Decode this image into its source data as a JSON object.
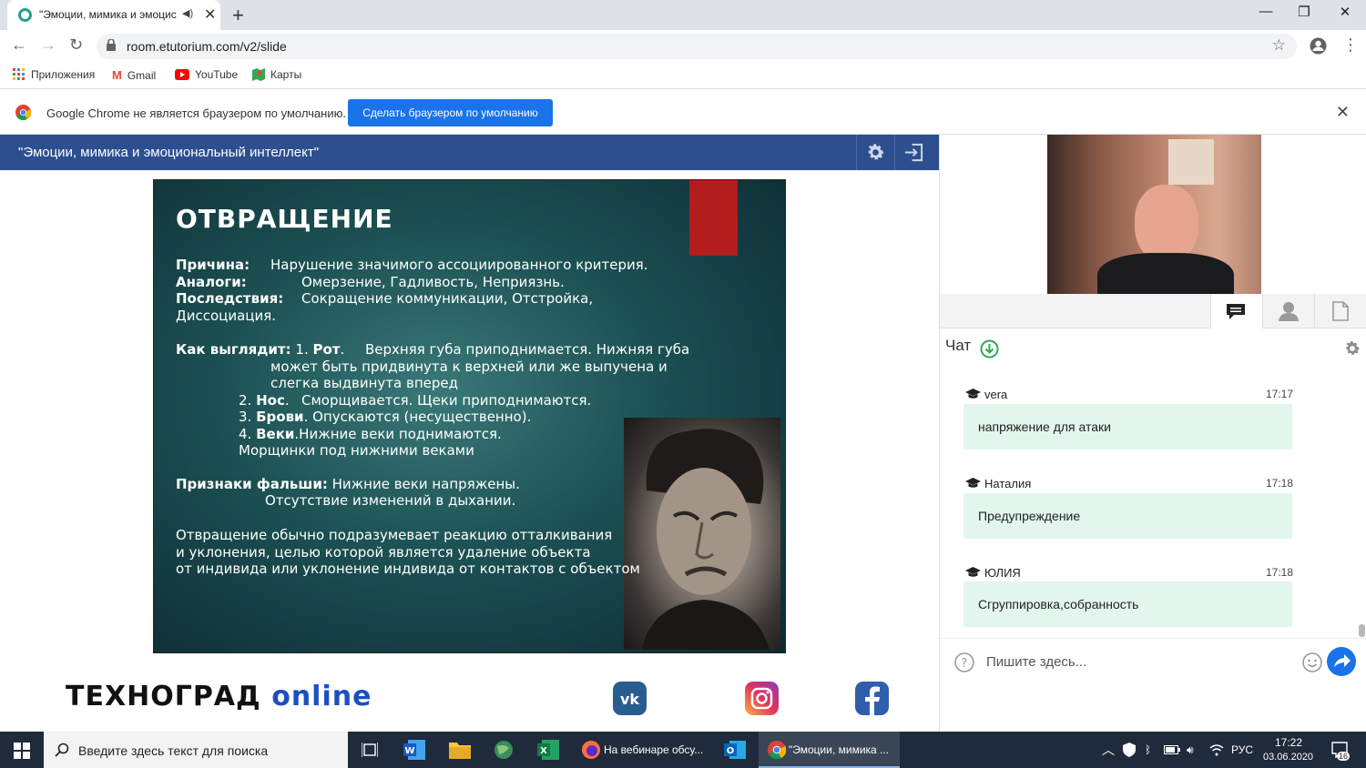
{
  "browser": {
    "tab_title": "\"Эмоции, мимика и эмоцис",
    "url": "room.etutorium.com/v2/slide",
    "bookmarks": [
      "Приложения",
      "Gmail",
      "YouTube",
      "Карты"
    ],
    "infobar_text": "Google Chrome не является браузером по умолчанию.",
    "infobar_button": "Сделать браузером по умолчанию"
  },
  "app": {
    "title": "\"Эмоции, мимика и эмоциональный интеллект\""
  },
  "slide": {
    "heading": "ОТВРАЩЕНИЕ",
    "cause_label": "Причина:",
    "cause_text": "Нарушение значимого ассоциированного критерия.",
    "analogs_label": "Аналоги:",
    "analogs_text": "Омерзение, Гадливость, Неприязнь.",
    "consequences_label": "Последствия:",
    "consequences_text": "Сокращение коммуникации, Отстройка,",
    "consequences_text2": "Диссоциация.",
    "looks_label": "Как выглядит:",
    "mouth_num": "1.",
    "mouth_label": "Рот",
    "mouth_text": "Верхняя губа приподнимается. Нижняя губа",
    "mouth_text2": "может быть придвинута к верхней или же выпучена и",
    "mouth_text3": "слегка выдвинута вперед",
    "nose_num": "2.",
    "nose_label": "Нос",
    "nose_text": "Сморщивается. Щеки приподнимаются.",
    "brows_num": "3.",
    "brows_label": "Брови",
    "brows_text": ". Опускаются (несущественно).",
    "lids_num": "4.",
    "lids_label": "Веки",
    "lids_text": ".Нижние веки поднимаются.",
    "wrinkles_text": "Морщинки под нижними веками",
    "false_label": "Признаки фальши:",
    "false_text": "Нижние веки напряжены.",
    "false_text2": "Отсутствие изменений в дыхании.",
    "summary1": "Отвращение обычно подразумевает реакцию отталкивания",
    "summary2": "и уклонения, целью которой является удаление объекта",
    "summary3": "от индивида или уклонение индивида от контактов с объектом"
  },
  "brand": {
    "name": "ТЕХНОГРАД",
    "suffix": "online"
  },
  "chat": {
    "title": "Чат",
    "messages": [
      {
        "user": "vera",
        "time": "17:17",
        "text": "напряжение для атаки"
      },
      {
        "user": "Наталия",
        "time": "17:18",
        "text": "Предупреждение"
      },
      {
        "user": "ЮЛИЯ",
        "time": "17:18",
        "text": "Сгруппировка,собранность"
      }
    ],
    "input_placeholder": "Пишите здесь..."
  },
  "taskbar": {
    "search_placeholder": "Введите здесь текст для поиска",
    "app1_label": "На вебинаре обсу...",
    "app2_label": "\"Эмоции, мимика ...",
    "lang": "РУС",
    "time": "17:22",
    "date": "03.06.2020",
    "notif_count": "16"
  },
  "colors": {
    "header": "#2d4f8f",
    "accent_blue": "#1a73e8",
    "chat_bubble": "#e3f6ec",
    "slide_red": "#b31d1d",
    "brand_online": "#1c4fc4"
  }
}
